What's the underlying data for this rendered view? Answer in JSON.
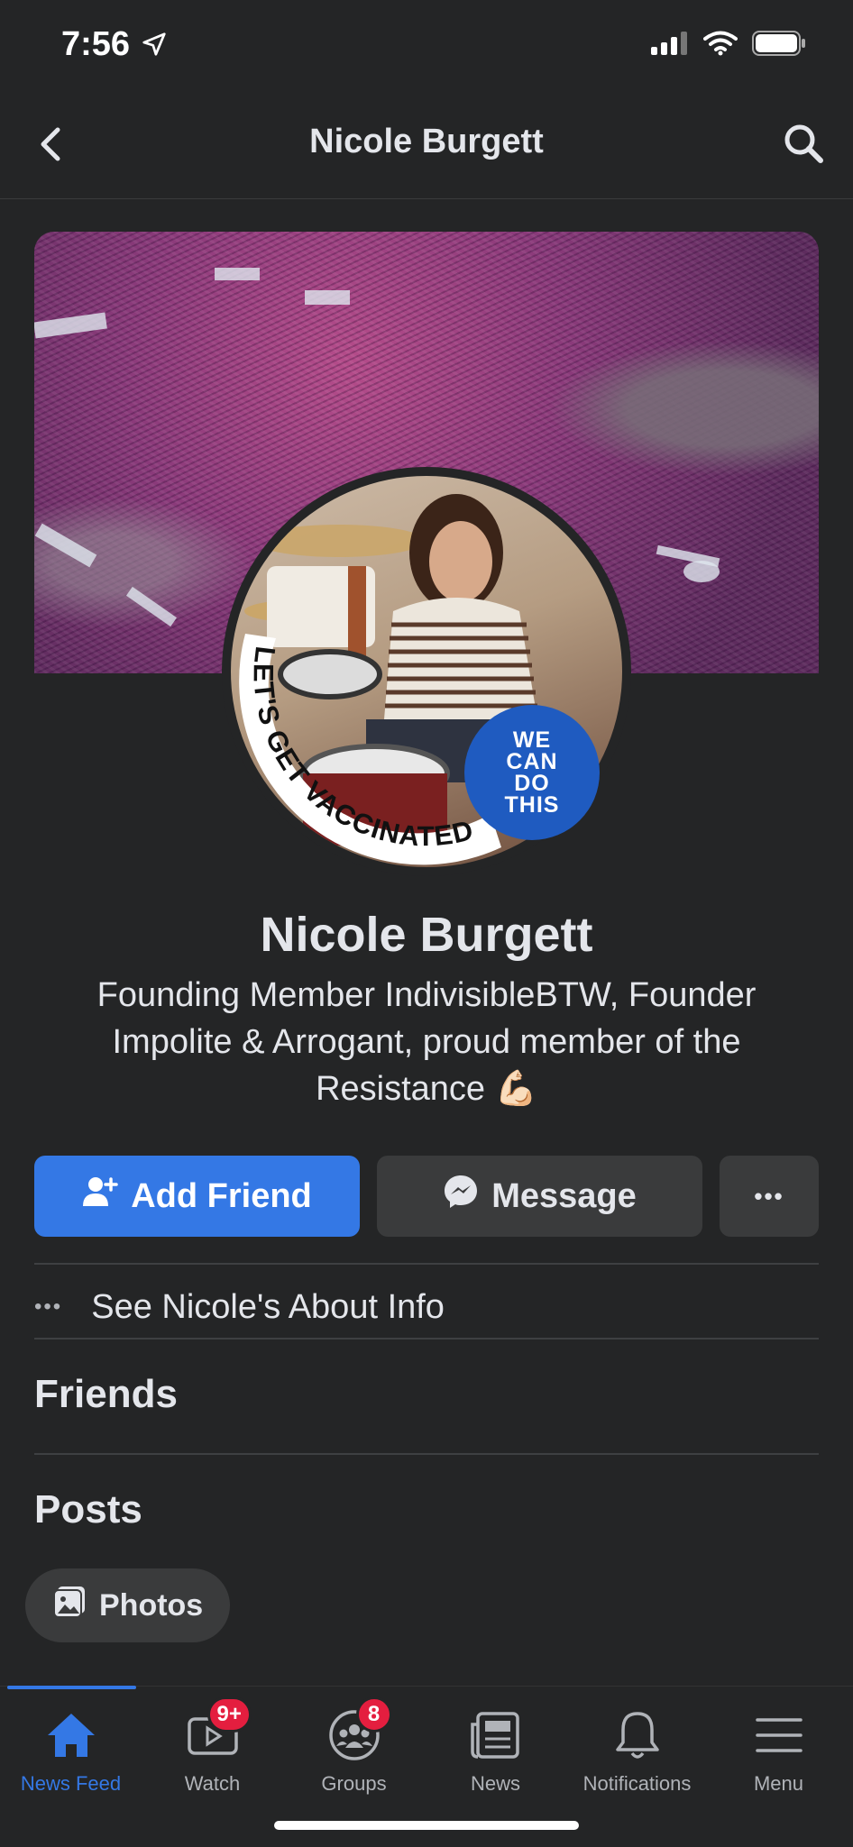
{
  "status_bar": {
    "time": "7:56",
    "icons": [
      "location-arrow-icon",
      "cellular-signal-icon",
      "wifi-icon",
      "battery-icon"
    ]
  },
  "header": {
    "title": "Nicole Burgett",
    "back_icon": "chevron-left-icon",
    "search_icon": "search-icon"
  },
  "profile": {
    "name": "Nicole Burgett",
    "bio": "Founding Member IndivisibleBTW, Founder Impolite & Arrogant, proud member of the Resistance 💪🏻",
    "frame_text": "LET'S GET VACCINATED",
    "badge_text": "WE CAN DO THIS"
  },
  "actions": {
    "add_friend": "Add Friend",
    "message": "Message",
    "more": "•••"
  },
  "about": {
    "dots": "•••",
    "label": "See Nicole's About Info"
  },
  "sections": {
    "friends": "Friends",
    "posts": "Posts"
  },
  "chips": {
    "photos": "Photos"
  },
  "bottom_nav": [
    {
      "label": "News Feed",
      "icon": "home-icon",
      "active": true,
      "badge": ""
    },
    {
      "label": "Watch",
      "icon": "video-icon",
      "active": false,
      "badge": "9+"
    },
    {
      "label": "Groups",
      "icon": "groups-icon",
      "active": false,
      "badge": "8"
    },
    {
      "label": "News",
      "icon": "news-icon",
      "active": false,
      "badge": ""
    },
    {
      "label": "Notifications",
      "icon": "bell-icon",
      "active": false,
      "badge": ""
    },
    {
      "label": "Menu",
      "icon": "hamburger-menu-icon",
      "active": false,
      "badge": ""
    }
  ],
  "colors": {
    "background": "#242526",
    "accent": "#3478e5",
    "button_secondary": "#3a3b3c",
    "badge_red": "#e41e3f",
    "text_primary": "#e4e6eb",
    "text_secondary": "#b0b3b8"
  }
}
